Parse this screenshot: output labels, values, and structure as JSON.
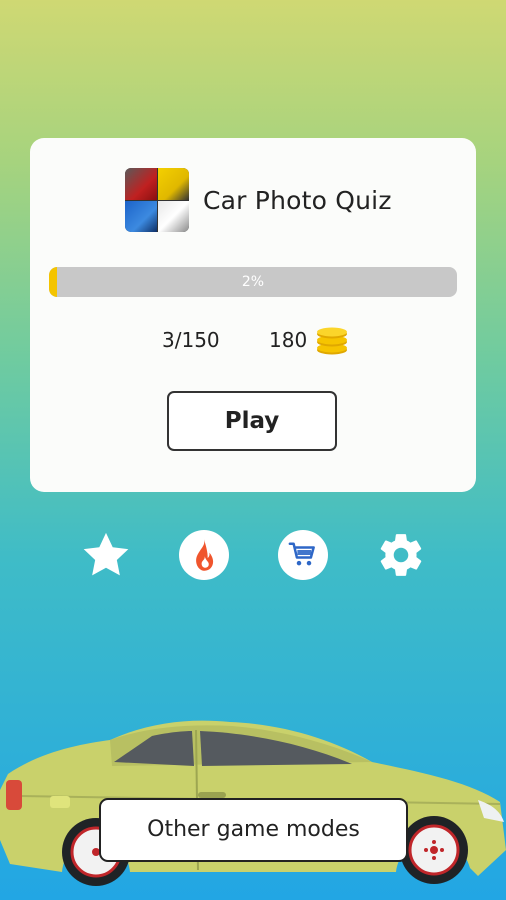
{
  "app": {
    "title": "Car Photo Quiz",
    "progress_label": "2%",
    "progress_value": 0.02,
    "count": "3/150",
    "coins": "180",
    "play_label": "Play"
  },
  "toolbar": {
    "icons": [
      "star-icon",
      "fire-icon",
      "cart-icon",
      "gear-icon"
    ]
  },
  "footer": {
    "modes_label": "Other game modes"
  },
  "colors": {
    "accent": "#f4c400",
    "fire": "#f0552d",
    "cart": "#2e67c7",
    "car_body": "#c9d16b"
  }
}
